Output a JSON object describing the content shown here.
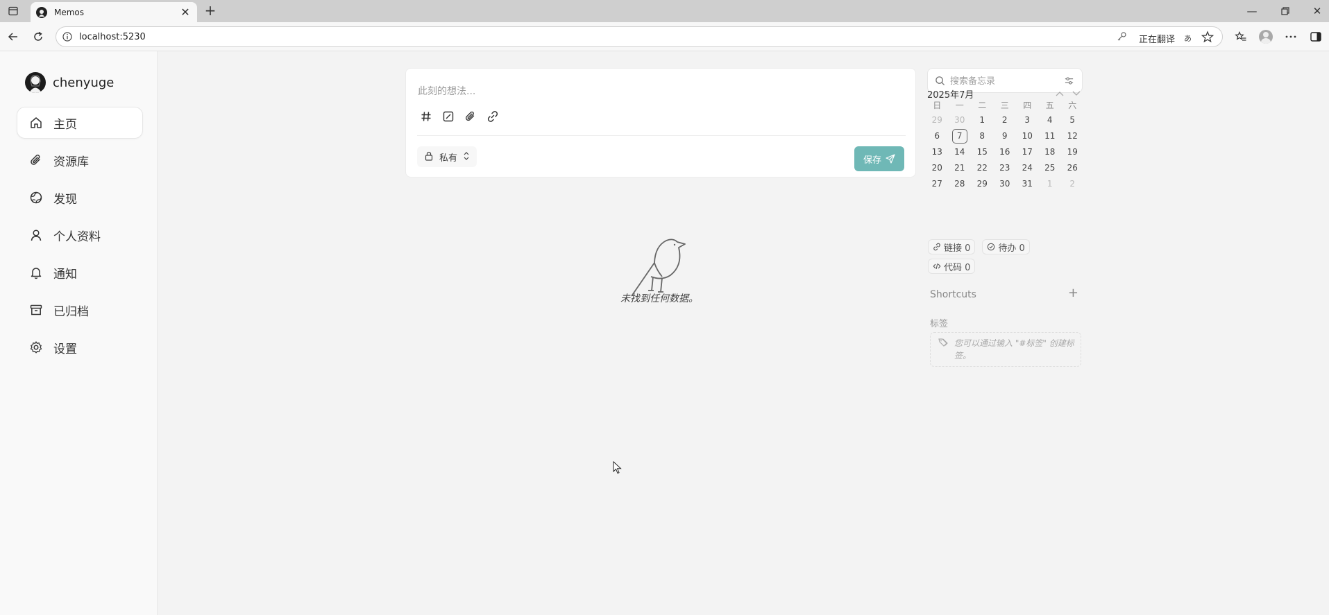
{
  "browser": {
    "tab_title": "Memos",
    "url": "localhost:5230",
    "translate_label": "正在翻译",
    "translate_icon_text": "あ"
  },
  "sidebar": {
    "user_name": "chenyuge",
    "items": [
      {
        "label": "主页",
        "icon": "home-icon"
      },
      {
        "label": "资源库",
        "icon": "paperclip-icon"
      },
      {
        "label": "发现",
        "icon": "globe-icon"
      },
      {
        "label": "个人资料",
        "icon": "user-icon"
      },
      {
        "label": "通知",
        "icon": "bell-icon"
      },
      {
        "label": "已归档",
        "icon": "archive-icon"
      },
      {
        "label": "设置",
        "icon": "gear-icon"
      }
    ]
  },
  "editor": {
    "placeholder": "此刻的想法...",
    "visibility": "私有",
    "save_label": "保存"
  },
  "empty_state": {
    "message": "未找到任何数据。"
  },
  "search": {
    "placeholder": "搜索备忘录"
  },
  "calendar": {
    "title": "2025年7月",
    "weekdays": [
      "日",
      "一",
      "二",
      "三",
      "四",
      "五",
      "六"
    ],
    "weeks": [
      [
        "29",
        "30",
        "1",
        "2",
        "3",
        "4",
        "5"
      ],
      [
        "6",
        "7",
        "8",
        "9",
        "10",
        "11",
        "12"
      ],
      [
        "13",
        "14",
        "15",
        "16",
        "17",
        "18",
        "19"
      ],
      [
        "20",
        "21",
        "22",
        "23",
        "24",
        "25",
        "26"
      ],
      [
        "27",
        "28",
        "29",
        "30",
        "31",
        "1",
        "2"
      ]
    ],
    "today": "7"
  },
  "stats": {
    "links": "链接 0",
    "todo": "待办 0",
    "code": "代码 0"
  },
  "shortcuts": {
    "title": "Shortcuts"
  },
  "tags": {
    "title": "标签",
    "hint": "您可以通过输入 \"#标签\" 创建标签。"
  },
  "colors": {
    "accent": "#6fb8b6",
    "background": "#f3f3f3",
    "sidebar": "#f9f9f9"
  }
}
